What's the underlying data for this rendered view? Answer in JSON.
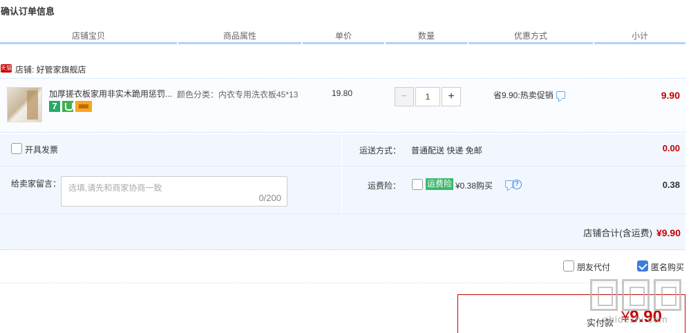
{
  "page": {
    "title": "确认订单信息"
  },
  "columns": [
    "店铺宝贝",
    "商品属性",
    "单价",
    "数量",
    "优惠方式",
    "小计"
  ],
  "shop": {
    "badge": "天猫",
    "label": "店铺: 好管家旗舰店"
  },
  "item": {
    "title": "加厚搓衣板家用非实木跪用惩罚...",
    "icons": [
      "seven-day-return-icon",
      "guarantee-shield-icon",
      "credit-card-icon"
    ],
    "icon_7": "7",
    "property": "颜色分类：内衣专用洗衣板45*13",
    "price": "19.80",
    "quantity": "1",
    "minus": "−",
    "plus": "+",
    "promo": "省9.90:热卖促销",
    "subtotal": "9.90"
  },
  "options": {
    "invoice_label": "开具发票",
    "ship_label": "运送方式：",
    "ship_value": "普通配送 快递 免邮",
    "ship_fee": "0.00",
    "message_label": "给卖家留言：",
    "message_placeholder": "选填,请先和商家协商一致",
    "message_count": "0/200",
    "insurance_label": "运费险：",
    "insurance_badge": "运费险",
    "insurance_price": "¥0.38购买",
    "insurance_help": "?",
    "insurance_fee": "0.38",
    "shop_total_label": "店铺合计(含运费)",
    "shop_total_amount": "¥9.90"
  },
  "bottom": {
    "friend_pay_label": "朋友代付",
    "anonymous_label": "匿名购买",
    "anonymous_checked": true
  },
  "payment": {
    "label": "实付款",
    "currency": "¥",
    "amount": "9.90"
  },
  "watermark": {
    "text": "zhidezhi.com"
  },
  "colors": {
    "accent_red": "#c40000",
    "header_rule": "#b2d1ff",
    "option_bg": "#f2f7ff",
    "checkbox_blue": "#3b7ddd",
    "insurance_green": "#3ab86b"
  }
}
